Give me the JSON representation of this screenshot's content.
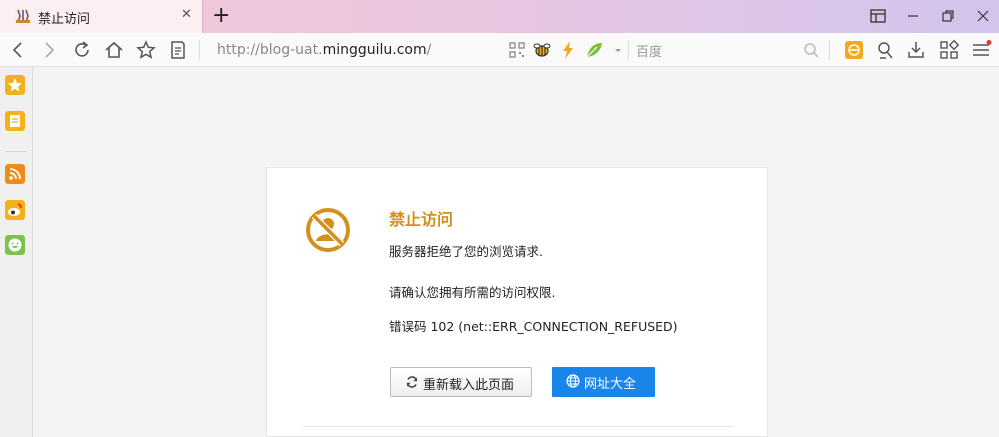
{
  "tab": {
    "title": "禁止访问",
    "close": "✕",
    "new_tab": "+"
  },
  "window_controls": [
    "sidebar-toggle-icon",
    "minimize-icon",
    "restore-icon",
    "close-icon"
  ],
  "toolbar": {
    "url_prefix": "http://blog-uat.",
    "url_host": "mingguilu.com",
    "url_suffix": "/",
    "search_placeholder": "百度"
  },
  "sidebar": {
    "items": [
      "favorites-icon",
      "notes-icon",
      "rss-icon",
      "weibo-icon",
      "smiley-icon"
    ]
  },
  "error": {
    "title": "禁止访问",
    "line1": "服务器拒绝了您的浏览请求.",
    "line2": "请确认您拥有所需的访问权限.",
    "code": "错误码 102 (net::ERR_CONNECTION_REFUSED)",
    "reload_label": "重新载入此页面",
    "nav_label": "网址大全"
  },
  "colors": {
    "accent": "#d4901e",
    "primary_button": "#1a85e8",
    "tab_gradient_start": "#f4c8d8",
    "tab_gradient_end": "#d2c4ec"
  }
}
